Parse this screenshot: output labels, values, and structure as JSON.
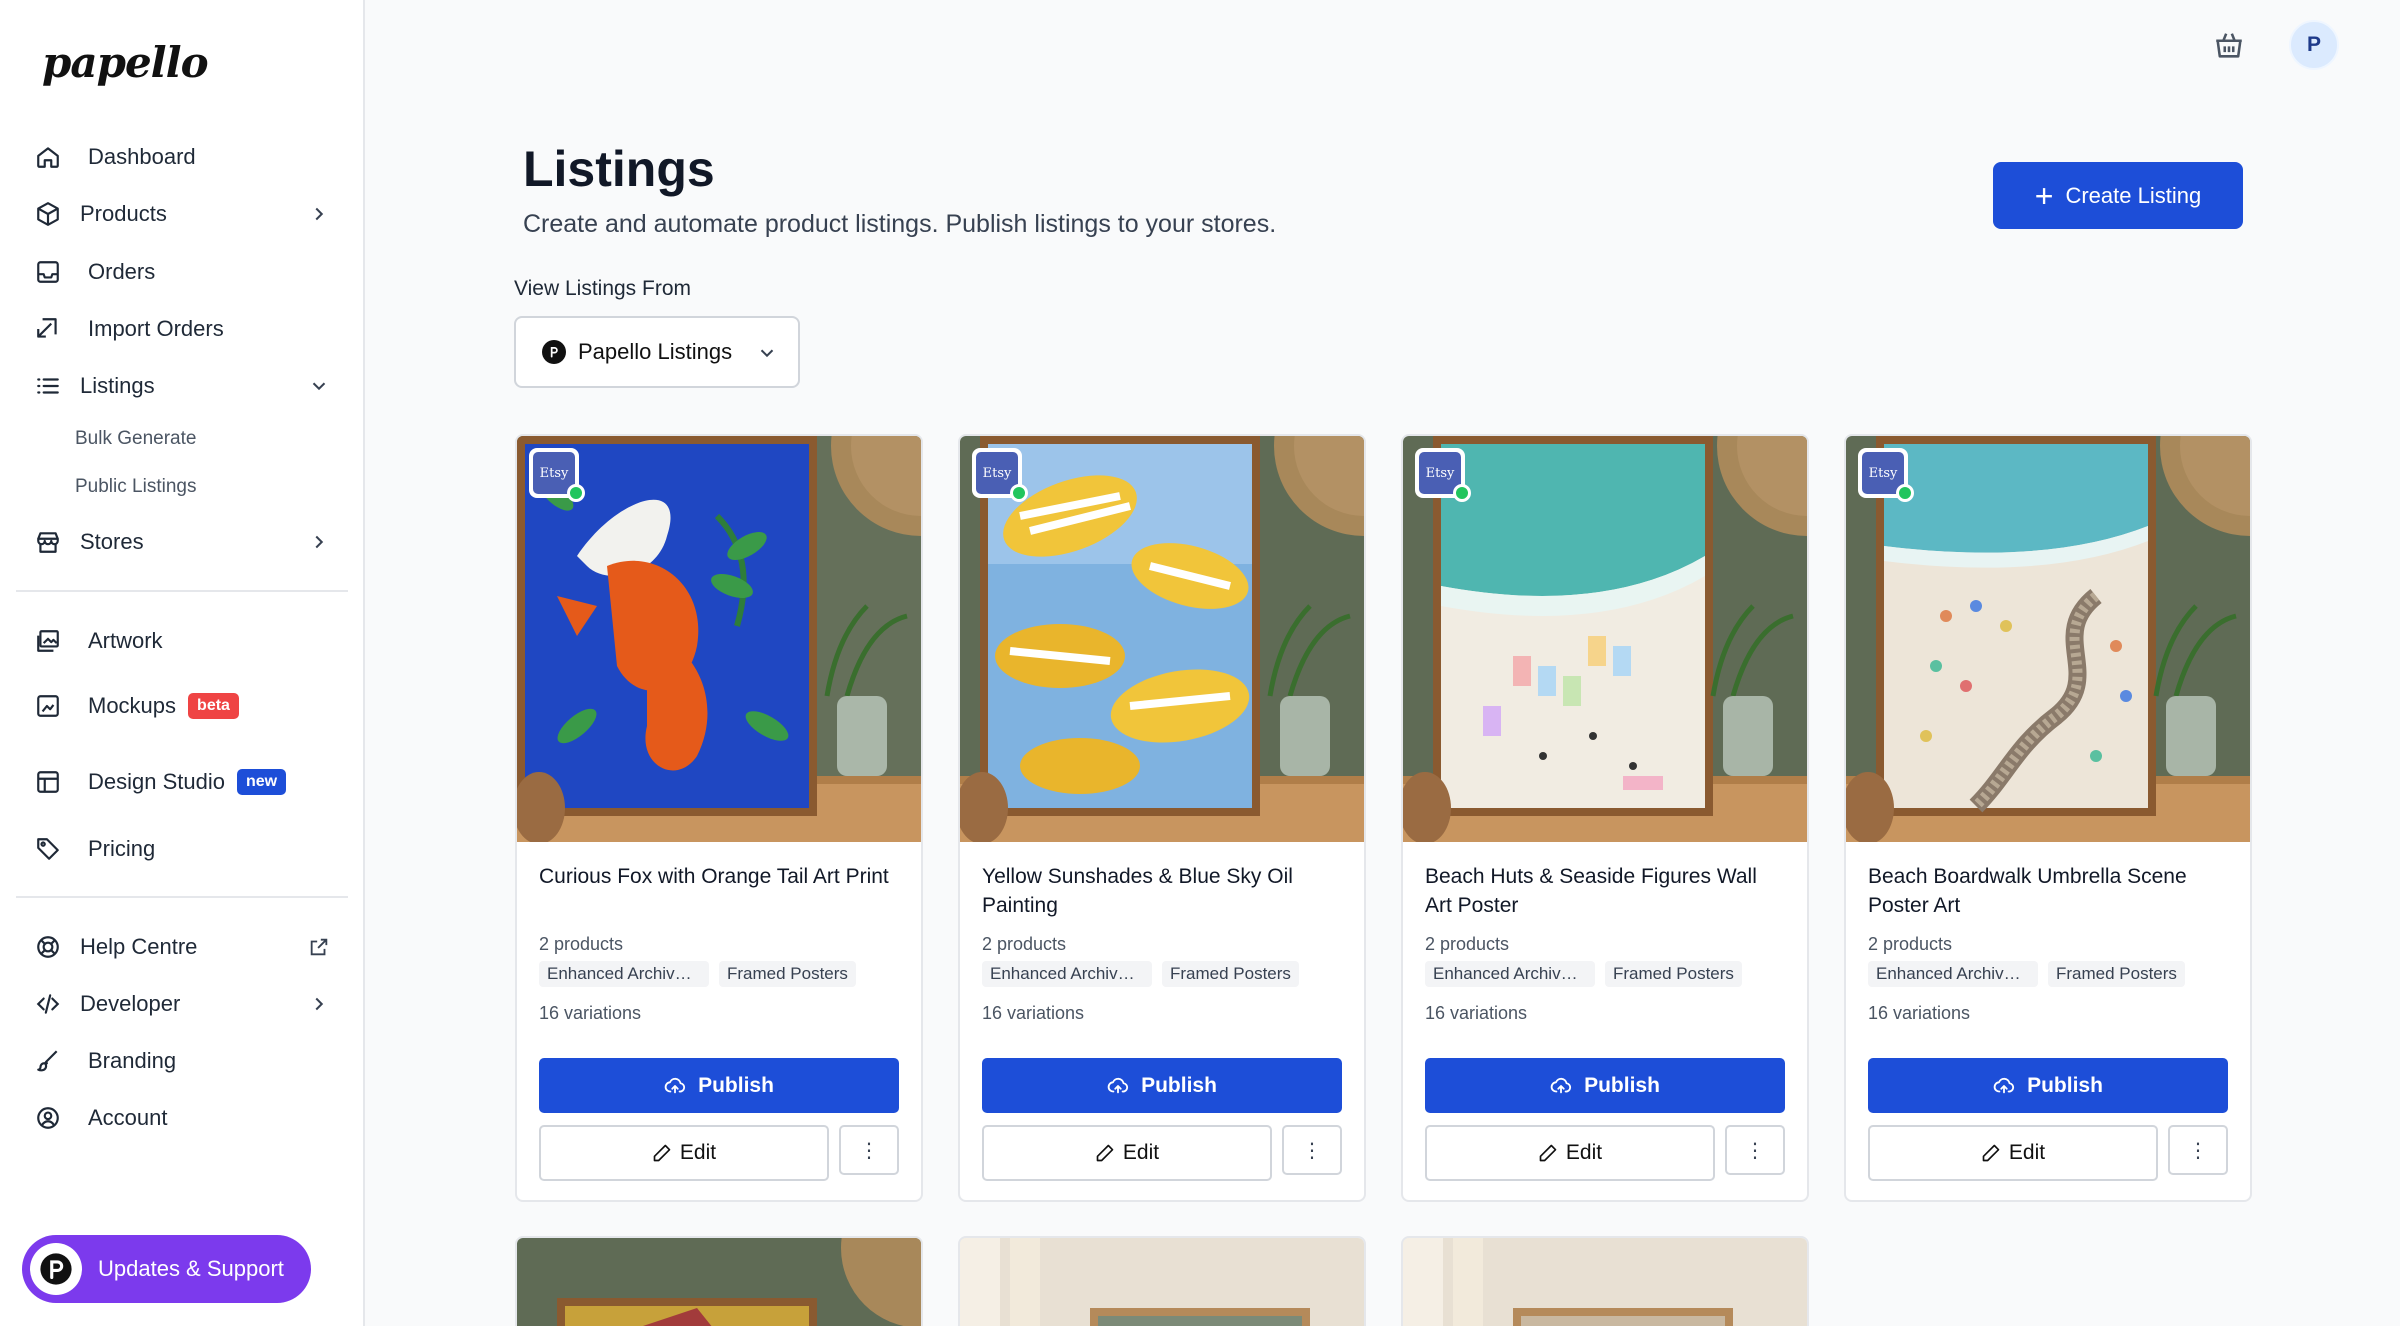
{
  "app": {
    "logo": "papello"
  },
  "sidebar": {
    "items": [
      {
        "label": "Dashboard"
      },
      {
        "label": "Products"
      },
      {
        "label": "Orders"
      },
      {
        "label": "Import Orders"
      },
      {
        "label": "Listings"
      },
      {
        "label": "Stores"
      },
      {
        "label": "Artwork"
      },
      {
        "label": "Mockups",
        "badge": "beta"
      },
      {
        "label": "Design Studio",
        "badge": "new"
      },
      {
        "label": "Pricing"
      },
      {
        "label": "Help Centre"
      },
      {
        "label": "Developer"
      },
      {
        "label": "Branding"
      },
      {
        "label": "Account"
      }
    ],
    "listings_sub": [
      {
        "label": "Bulk Generate"
      },
      {
        "label": "Public Listings"
      }
    ],
    "updates_label": "Updates & Support"
  },
  "topbar": {
    "avatar_initial": "P"
  },
  "header": {
    "title": "Listings",
    "subtitle": "Create and automate product listings. Publish listings to your stores.",
    "create_label": "Create Listing"
  },
  "filter": {
    "label": "View Listings From",
    "selected": "Papello Listings"
  },
  "cards": [
    {
      "store": "Etsy",
      "title": "Curious Fox with Orange Tail Art Print",
      "products": "2 products",
      "tags": [
        "Enhanced Archival Matte Paper Posters",
        "Framed Posters"
      ],
      "variations": "16 variations",
      "publish_label": "Publish",
      "edit_label": "Edit"
    },
    {
      "store": "Etsy",
      "title": "Yellow Sunshades & Blue Sky Oil Painting",
      "products": "2 products",
      "tags": [
        "Enhanced Archival Matte Paper Posters",
        "Framed Posters"
      ],
      "variations": "16 variations",
      "publish_label": "Publish",
      "edit_label": "Edit"
    },
    {
      "store": "Etsy",
      "title": "Beach Huts & Seaside Figures Wall Art Poster",
      "products": "2 products",
      "tags": [
        "Enhanced Archival Matte Paper Posters",
        "Framed Posters"
      ],
      "variations": "16 variations",
      "publish_label": "Publish",
      "edit_label": "Edit"
    },
    {
      "store": "Etsy",
      "title": "Beach Boardwalk Umbrella Scene Poster Art",
      "products": "2 products",
      "tags": [
        "Enhanced Archival Matte Paper Posters",
        "Framed Posters"
      ],
      "variations": "16 variations",
      "publish_label": "Publish",
      "edit_label": "Edit"
    }
  ],
  "colors": {
    "primary": "#1d4ed8",
    "updates": "#7c3aed",
    "beta": "#ef4444",
    "online": "#22c55e",
    "etsy": "#4a5fb4"
  }
}
